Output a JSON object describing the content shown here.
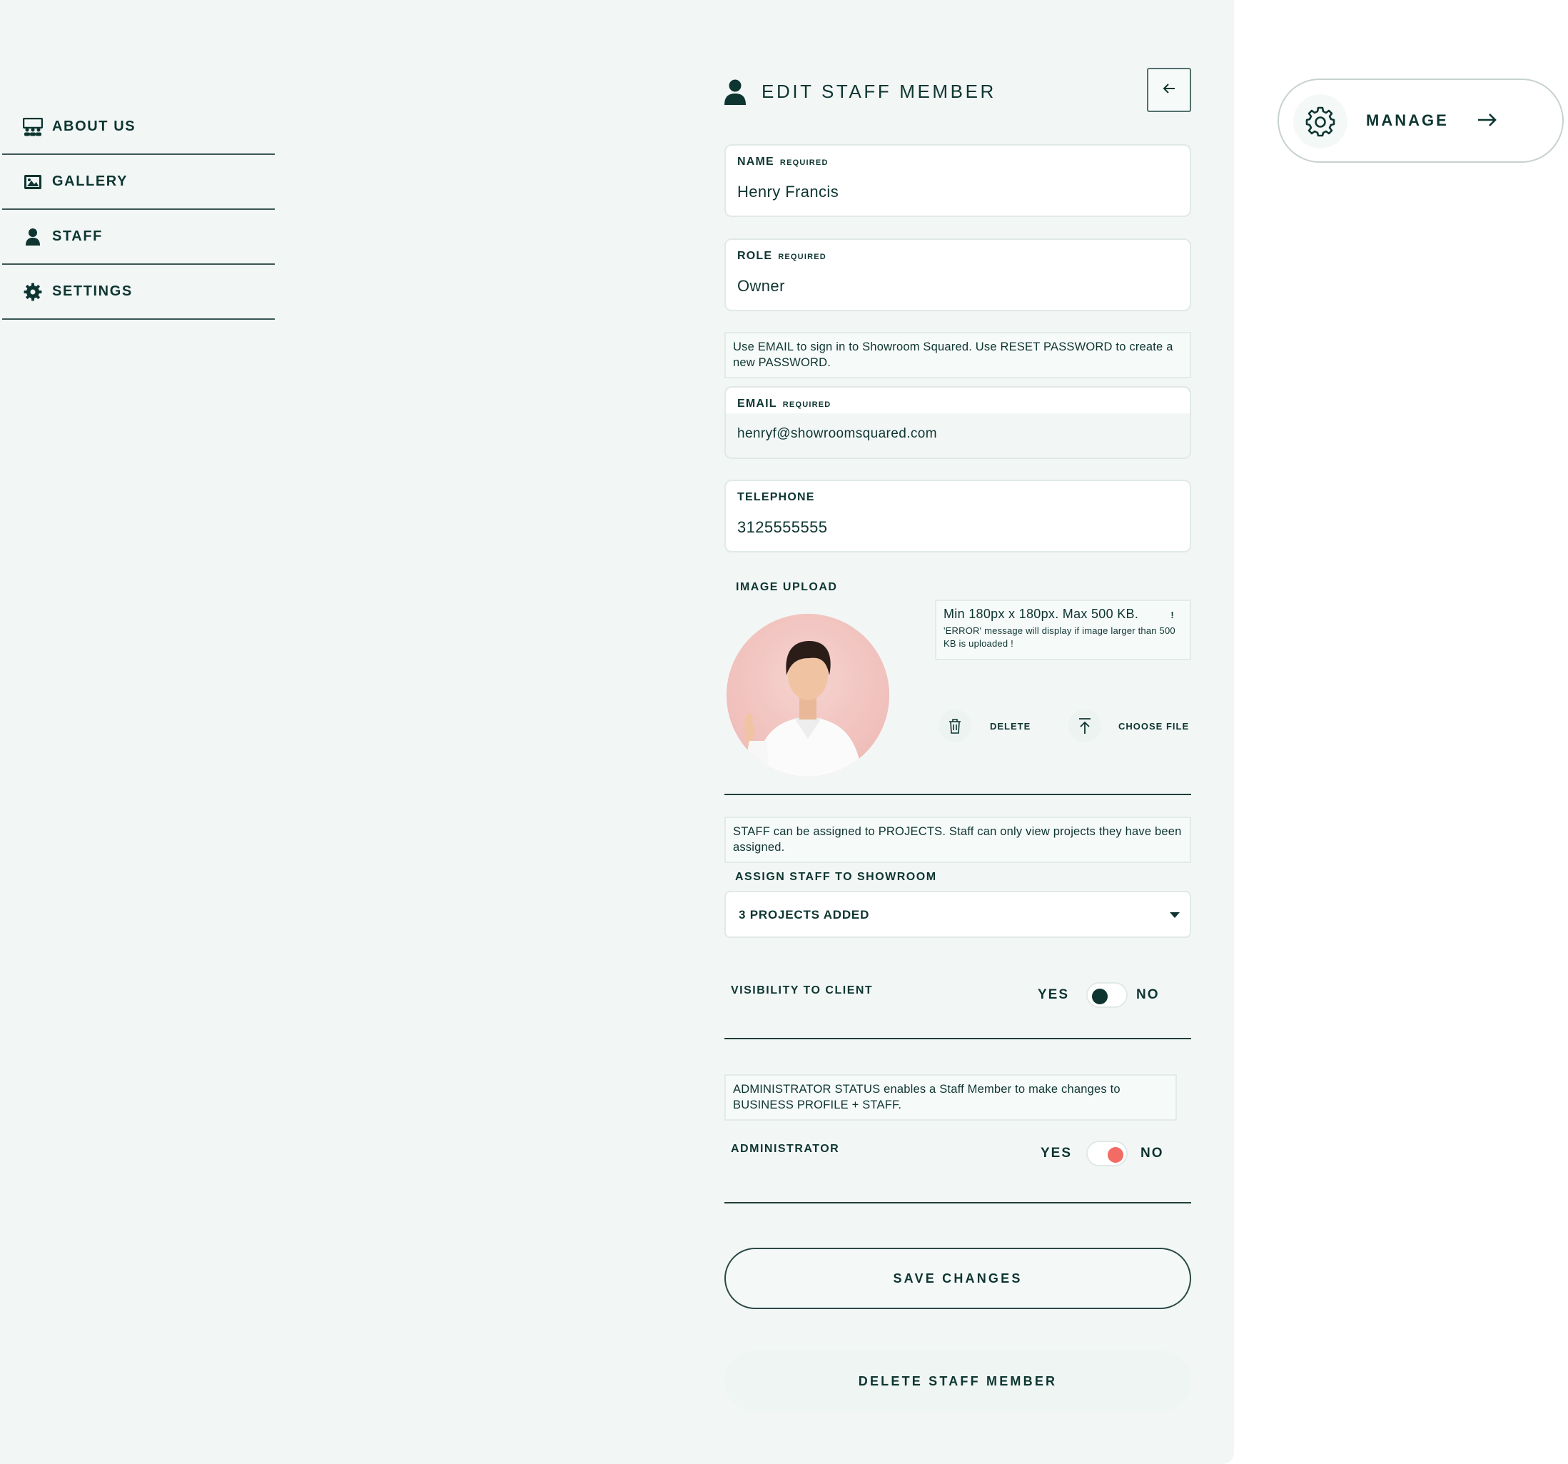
{
  "sidebar": {
    "items": [
      {
        "label": "ABOUT US",
        "icon": "team-icon"
      },
      {
        "label": "GALLERY",
        "icon": "image-icon"
      },
      {
        "label": "STAFF",
        "icon": "user-icon"
      },
      {
        "label": "SETTINGS",
        "icon": "gear-icon"
      }
    ]
  },
  "header": {
    "title": "EDIT STAFF MEMBER"
  },
  "form": {
    "name": {
      "label": "NAME",
      "required": "REQUIRED",
      "value": "Henry Francis"
    },
    "role": {
      "label": "ROLE",
      "required": "REQUIRED",
      "value": "Owner"
    },
    "email_note": "Use EMAIL to sign in to Showroom Squared. Use RESET PASSWORD to create a new PASSWORD.",
    "email": {
      "label": "EMAIL",
      "required": "REQUIRED",
      "value": "henryf@showroomsquared.com"
    },
    "telephone": {
      "label": "TELEPHONE",
      "value": "3125555555"
    },
    "image_upload": {
      "label": "IMAGE UPLOAD",
      "hint_main": "Min 180px x 180px. Max 500 KB.",
      "hint_bang": "!",
      "hint_sub": "'ERROR' message will display if image larger than 500 KB is uploaded !",
      "delete_label": "DELETE",
      "choose_label": "CHOOSE FILE"
    },
    "assign_note": "STAFF can be assigned to PROJECTS. Staff can only view projects they have been assigned.",
    "assign": {
      "label": "ASSIGN STAFF TO SHOWROOM",
      "value": "3 PROJECTS ADDED"
    },
    "visibility": {
      "label": "VISIBILITY TO CLIENT",
      "yes": "YES",
      "no": "NO",
      "state": "yes"
    },
    "admin_note": "ADMINISTRATOR STATUS enables a Staff Member to make changes to BUSINESS PROFILE + STAFF.",
    "administrator": {
      "label": "ADMINISTRATOR",
      "yes": "YES",
      "no": "NO",
      "state": "no"
    },
    "save_label": "SAVE CHANGES",
    "delete_member_label": "DELETE STAFF MEMBER"
  },
  "manage": {
    "label": "MANAGE"
  },
  "colors": {
    "panel_bg": "#f2f7f6",
    "text": "#0e3530",
    "toggle_on": "#0e3530",
    "toggle_off": "#f26b64"
  }
}
